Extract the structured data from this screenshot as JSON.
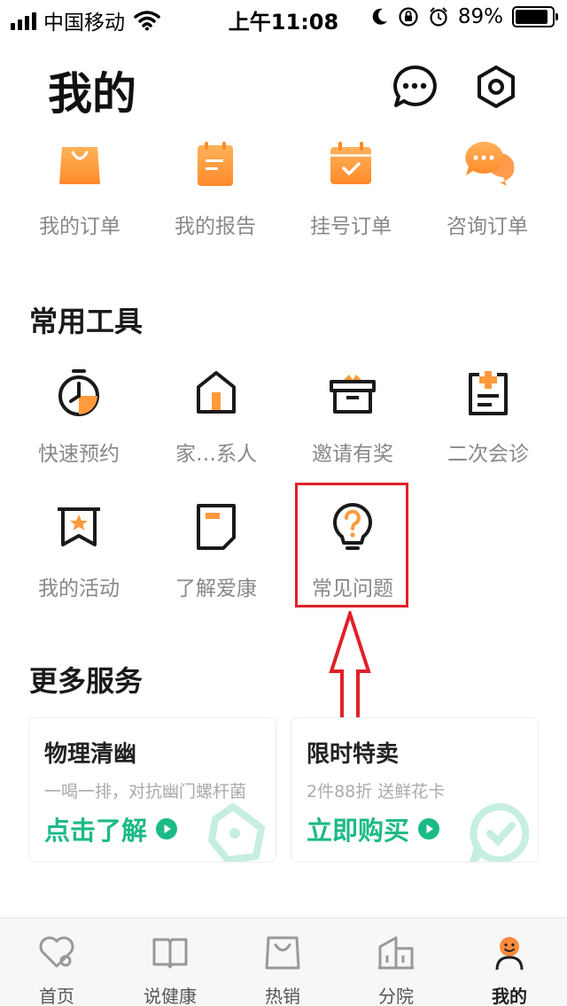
{
  "status_bar": {
    "carrier": "中国移动",
    "time": "上午11:08",
    "battery": "89%",
    "battery_fraction": 0.89
  },
  "header": {
    "title": "我的",
    "message_icon": "chat-bubble-icon",
    "settings_icon": "hexagon-settings-icon"
  },
  "orders": [
    {
      "label": "我的订单",
      "icon": "shopping-bag-icon"
    },
    {
      "label": "我的报告",
      "icon": "report-icon"
    },
    {
      "label": "挂号订单",
      "icon": "calendar-check-icon"
    },
    {
      "label": "咨询订单",
      "icon": "chat-icon"
    }
  ],
  "tools": {
    "title": "常用工具",
    "items": [
      {
        "label": "快速预约",
        "icon": "stopwatch-icon"
      },
      {
        "label": "家…系人",
        "icon": "home-icon"
      },
      {
        "label": "邀请有奖",
        "icon": "gift-icon"
      },
      {
        "label": "二次会诊",
        "icon": "clipboard-plus-icon"
      },
      {
        "label": "我的活动",
        "icon": "bookmark-star-icon"
      },
      {
        "label": "了解爱康",
        "icon": "document-icon"
      },
      {
        "label": "常见问题",
        "icon": "lightbulb-question-icon"
      }
    ]
  },
  "services": {
    "title": "更多服务",
    "cards": [
      {
        "title": "物理清幽",
        "subtitle": "一喝一排，对抗幽门螺杆菌",
        "cta": "点击了解"
      },
      {
        "title": "限时特卖",
        "subtitle": "2件88折 送鲜花卡",
        "cta": "立即购买"
      }
    ]
  },
  "tabbar": [
    {
      "label": "首页",
      "icon": "heart-home-icon"
    },
    {
      "label": "说健康",
      "icon": "book-icon"
    },
    {
      "label": "热销",
      "icon": "bag-icon"
    },
    {
      "label": "分院",
      "icon": "building-icon"
    },
    {
      "label": "我的",
      "icon": "user-icon",
      "active": true
    }
  ],
  "colors": {
    "accent_orange": "#ff9a3c",
    "accent_green": "#1cba87",
    "highlight_red": "#e0202a"
  }
}
